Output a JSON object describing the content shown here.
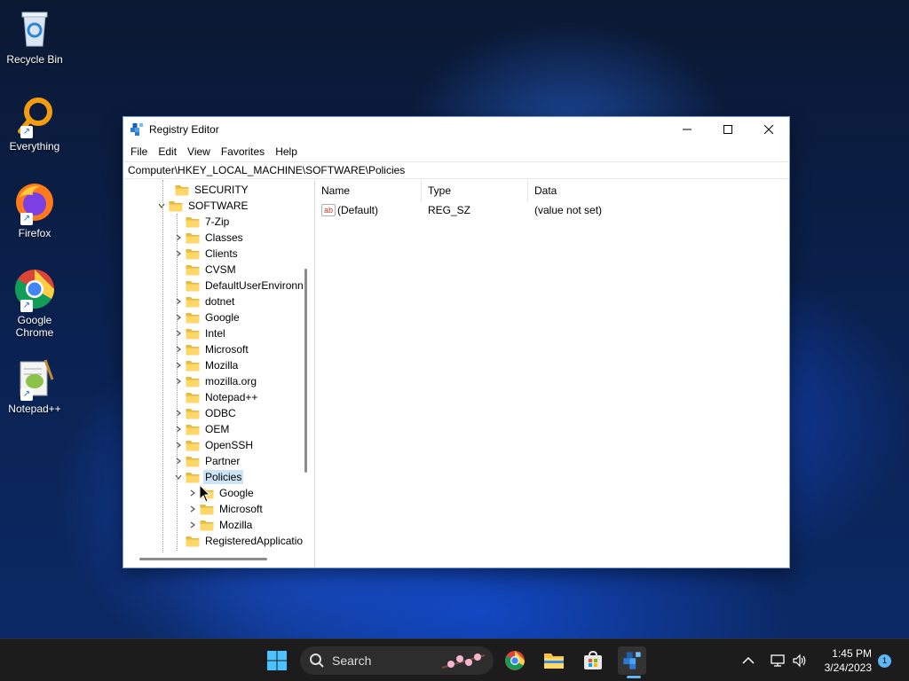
{
  "desktop": {
    "icons": [
      {
        "label": "Recycle Bin"
      },
      {
        "label": "Everything"
      },
      {
        "label": "Firefox"
      },
      {
        "label": "Google Chrome"
      },
      {
        "label": "Notepad++"
      }
    ]
  },
  "window": {
    "title": "Registry Editor",
    "menu": [
      "File",
      "Edit",
      "View",
      "Favorites",
      "Help"
    ],
    "address": "Computer\\HKEY_LOCAL_MACHINE\\SOFTWARE\\Policies",
    "tree": [
      {
        "label": "SECURITY",
        "chevron": ""
      },
      {
        "label": "SOFTWARE",
        "chevron": "v"
      },
      {
        "label": "7-Zip",
        "chevron": ""
      },
      {
        "label": "Classes",
        "chevron": ">"
      },
      {
        "label": "Clients",
        "chevron": ">"
      },
      {
        "label": "CVSM",
        "chevron": ""
      },
      {
        "label": "DefaultUserEnvironn",
        "chevron": ""
      },
      {
        "label": "dotnet",
        "chevron": ">"
      },
      {
        "label": "Google",
        "chevron": ">"
      },
      {
        "label": "Intel",
        "chevron": ">"
      },
      {
        "label": "Microsoft",
        "chevron": ">"
      },
      {
        "label": "Mozilla",
        "chevron": ">"
      },
      {
        "label": "mozilla.org",
        "chevron": ">"
      },
      {
        "label": "Notepad++",
        "chevron": ""
      },
      {
        "label": "ODBC",
        "chevron": ">"
      },
      {
        "label": "OEM",
        "chevron": ">"
      },
      {
        "label": "OpenSSH",
        "chevron": ">"
      },
      {
        "label": "Partner",
        "chevron": ">"
      },
      {
        "label": "Policies",
        "chevron": "v",
        "selected": true
      },
      {
        "label": "Google",
        "chevron": ">"
      },
      {
        "label": "Microsoft",
        "chevron": ">"
      },
      {
        "label": "Mozilla",
        "chevron": ">"
      },
      {
        "label": "RegisteredApplicatio",
        "chevron": ""
      }
    ],
    "list": {
      "columns": [
        "Name",
        "Type",
        "Data"
      ],
      "rows": [
        {
          "name": "(Default)",
          "type": "REG_SZ",
          "data": "(value not set)"
        }
      ]
    }
  },
  "taskbar": {
    "search_label": "Search",
    "time": "1:45 PM",
    "date": "3/24/2023",
    "notification_count": "1"
  }
}
